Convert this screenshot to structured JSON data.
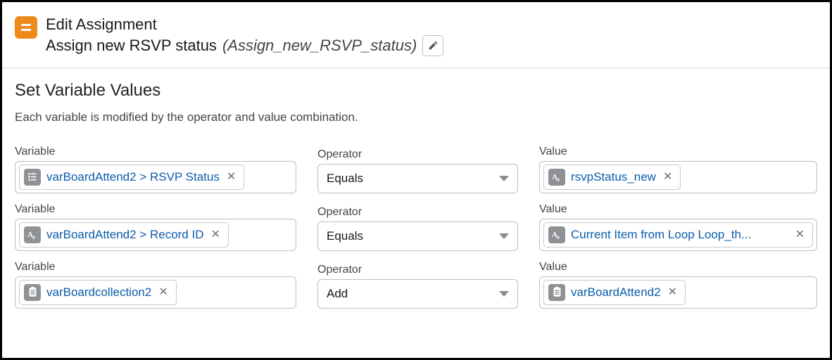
{
  "header": {
    "title": "Edit Assignment",
    "name": "Assign new RSVP status",
    "api_name": "(Assign_new_RSVP_status)"
  },
  "section": {
    "title": "Set Variable Values",
    "desc": "Each variable is modified by the operator and value combination."
  },
  "labels": {
    "variable": "Variable",
    "operator": "Operator",
    "value": "Value"
  },
  "rows": [
    {
      "variable": {
        "icon": "picklist",
        "text": "varBoardAttend2 > RSVP Status"
      },
      "operator": "Equals",
      "value": {
        "icon": "text",
        "text": "rsvpStatus_new"
      }
    },
    {
      "variable": {
        "icon": "text",
        "text": "varBoardAttend2 > Record ID"
      },
      "operator": "Equals",
      "value": {
        "icon": "text",
        "text": "Current Item from Loop Loop_th..."
      }
    },
    {
      "variable": {
        "icon": "record",
        "text": "varBoardcollection2"
      },
      "operator": "Add",
      "value": {
        "icon": "record",
        "text": "varBoardAttend2"
      }
    }
  ]
}
